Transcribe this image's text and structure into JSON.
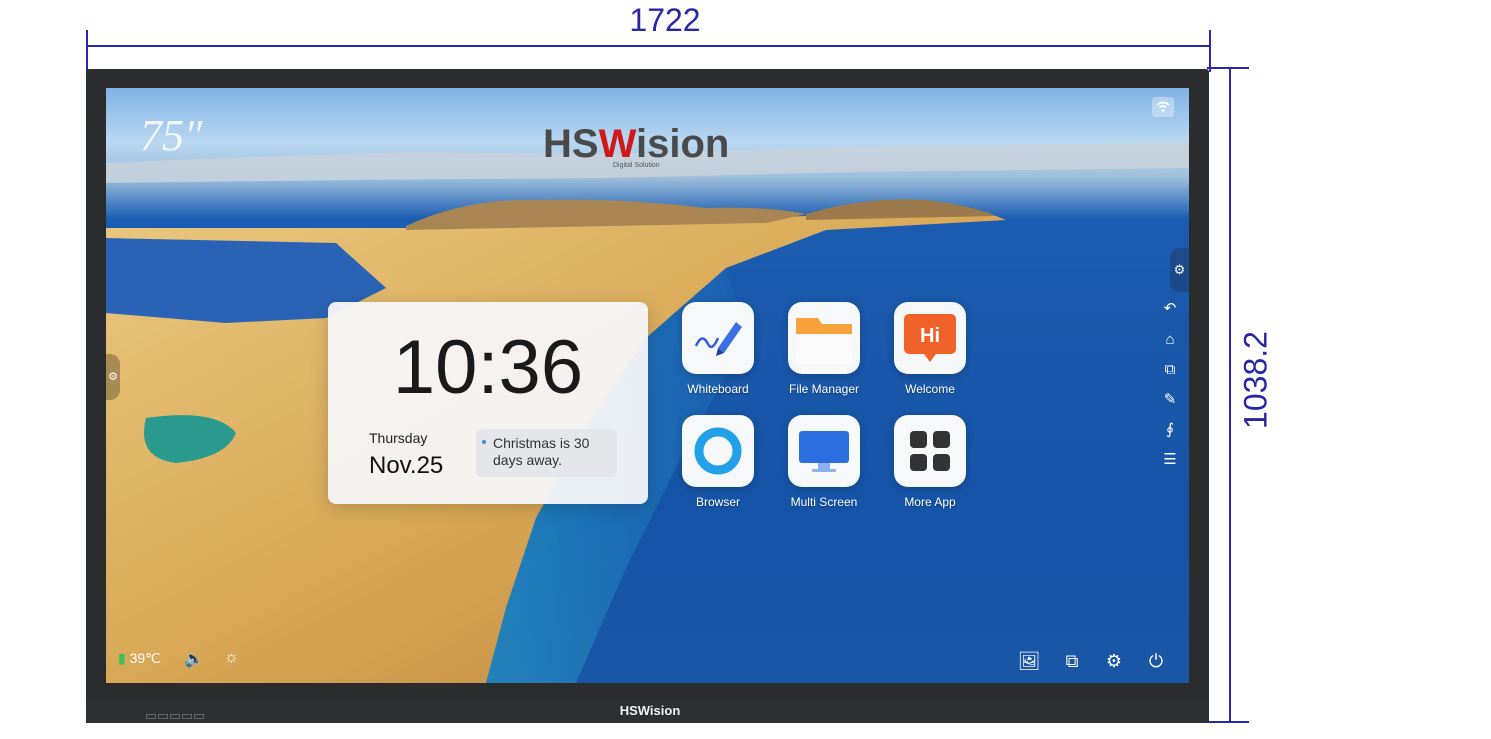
{
  "dimensions": {
    "width_label": "1722",
    "height_label": "1038.2"
  },
  "colors": {
    "dimension_line": "#2a2aa8",
    "bezel": "#2b2c2e",
    "logo_accent": "#d01818"
  },
  "screen": {
    "size_label": "75″",
    "logo": {
      "part1": "HSW",
      "part2": "ision",
      "tagline": "Digital Solution"
    },
    "wifi_icon": "wifi-icon"
  },
  "clock": {
    "time": "10:36",
    "weekday": "Thursday",
    "date": "Nov.25",
    "note": "Christmas is 30 days away."
  },
  "apps": [
    {
      "label": "Whiteboard",
      "icon": "whiteboard-pen-icon"
    },
    {
      "label": "File Manager",
      "icon": "folder-icon"
    },
    {
      "label": "Welcome",
      "icon": "hi-bubble-icon"
    },
    {
      "label": "Browser",
      "icon": "browser-ring-icon"
    },
    {
      "label": "Multi Screen",
      "icon": "monitor-icon"
    },
    {
      "label": "More App",
      "icon": "grid-icon"
    }
  ],
  "sidebar": {
    "settings_glyph": "⚙",
    "buttons": [
      {
        "name": "back",
        "glyph": "↶"
      },
      {
        "name": "home",
        "glyph": "⌂"
      },
      {
        "name": "windows",
        "glyph": "⧉"
      },
      {
        "name": "annotate",
        "glyph": "✎"
      },
      {
        "name": "signal-source",
        "glyph": "∮"
      },
      {
        "name": "toolbox",
        "glyph": "☰"
      }
    ]
  },
  "status": {
    "temperature": "39℃",
    "volume_glyph": "🔈",
    "brightness_glyph": "☼"
  },
  "tray": [
    {
      "name": "gallery",
      "glyph": "🖼"
    },
    {
      "name": "screenshot",
      "glyph": "⧉"
    },
    {
      "name": "settings",
      "glyph": "⚙"
    },
    {
      "name": "power",
      "glyph": "⏻"
    }
  ],
  "bezel": {
    "brand": "HSWision"
  }
}
